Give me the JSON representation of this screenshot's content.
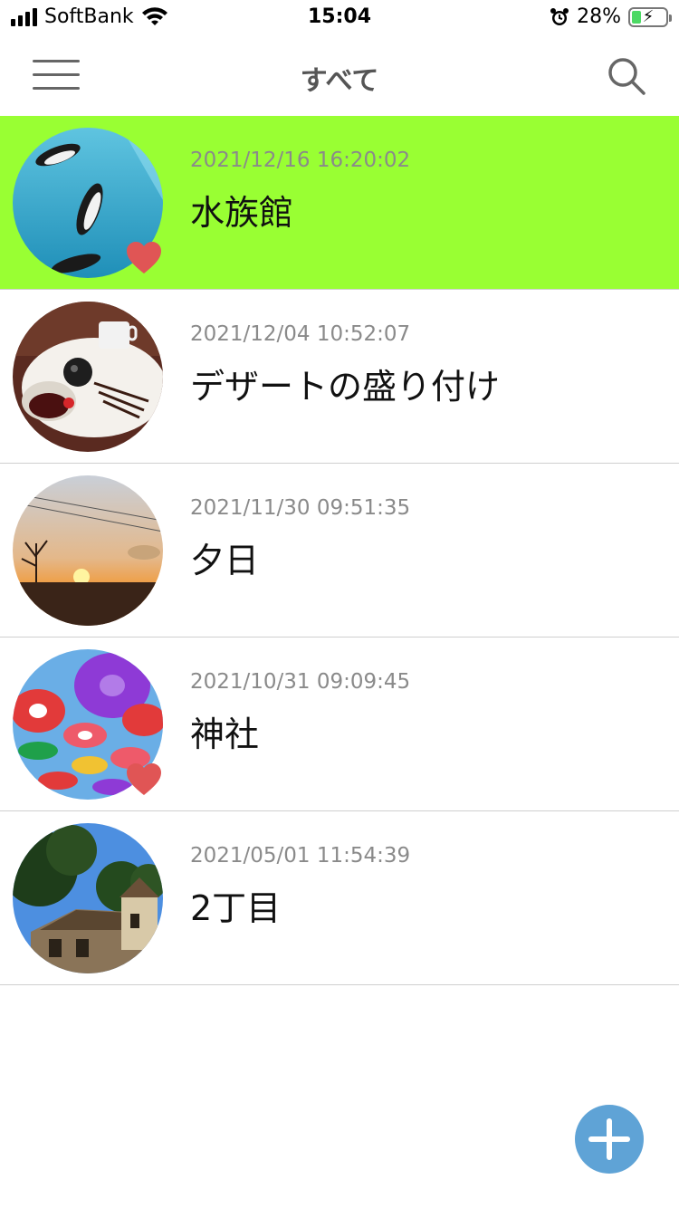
{
  "status_bar": {
    "carrier": "SoftBank",
    "time": "15:04",
    "battery_percent": "28%",
    "battery_level": 0.28,
    "icons": [
      "signal-icon",
      "wifi-icon",
      "alarm-icon",
      "battery-charging-icon"
    ]
  },
  "nav": {
    "title": "すべて",
    "left_icon": "hamburger-menu-icon",
    "right_icon": "search-icon"
  },
  "entries": [
    {
      "date": "2021/12/16 16:20:02",
      "title": "水族館",
      "favorite": true,
      "selected": true,
      "thumb": "penguins-aquarium"
    },
    {
      "date": "2021/12/04 10:52:07",
      "title": "デザートの盛り付け",
      "favorite": false,
      "selected": false,
      "thumb": "dessert-plate"
    },
    {
      "date": "2021/11/30 09:51:35",
      "title": "夕日",
      "favorite": false,
      "selected": false,
      "thumb": "sunset"
    },
    {
      "date": "2021/10/31 09:09:45",
      "title": "神社",
      "favorite": true,
      "selected": false,
      "thumb": "umbrellas"
    },
    {
      "date": "2021/05/01 11:54:39",
      "title": "2丁目",
      "favorite": false,
      "selected": false,
      "thumb": "house-trees"
    }
  ],
  "fab": {
    "icon": "plus-icon"
  },
  "colors": {
    "selected_row": "#99ff33",
    "heart": "#e05555",
    "fab": "#5fa3d6",
    "date_text": "#8a8a8a"
  }
}
